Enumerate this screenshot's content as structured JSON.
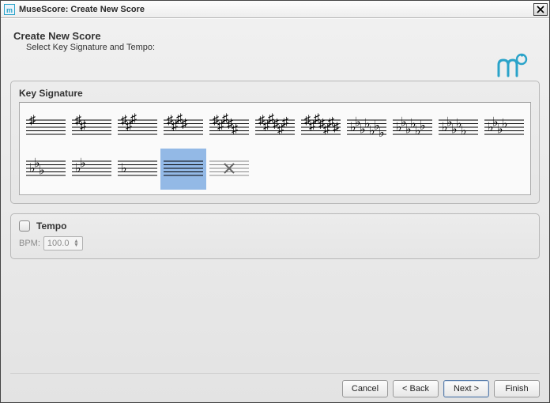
{
  "window": {
    "title": "MuseScore: Create New Score"
  },
  "page": {
    "heading": "Create New Score",
    "subheading": "Select Key Signature and Tempo:"
  },
  "key_signature": {
    "title": "Key Signature",
    "selected_index": 14,
    "options": [
      {
        "type": "sharp",
        "count": 1
      },
      {
        "type": "sharp",
        "count": 2
      },
      {
        "type": "sharp",
        "count": 3
      },
      {
        "type": "sharp",
        "count": 4
      },
      {
        "type": "sharp",
        "count": 5
      },
      {
        "type": "sharp",
        "count": 6
      },
      {
        "type": "sharp",
        "count": 7
      },
      {
        "type": "flat",
        "count": 7
      },
      {
        "type": "flat",
        "count": 6
      },
      {
        "type": "flat",
        "count": 5
      },
      {
        "type": "flat",
        "count": 4
      },
      {
        "type": "flat",
        "count": 3
      },
      {
        "type": "flat",
        "count": 2
      },
      {
        "type": "flat",
        "count": 1
      },
      {
        "type": "none",
        "count": 0
      },
      {
        "type": "natural",
        "count": 1
      }
    ]
  },
  "tempo": {
    "title": "Tempo",
    "enabled": false,
    "bpm_label": "BPM:",
    "bpm_value": "100.0"
  },
  "buttons": {
    "cancel": "Cancel",
    "back": "< Back",
    "next": "Next >",
    "finish": "Finish"
  },
  "colors": {
    "selection": "#93b9e6",
    "brand": "#2aa3c9"
  }
}
